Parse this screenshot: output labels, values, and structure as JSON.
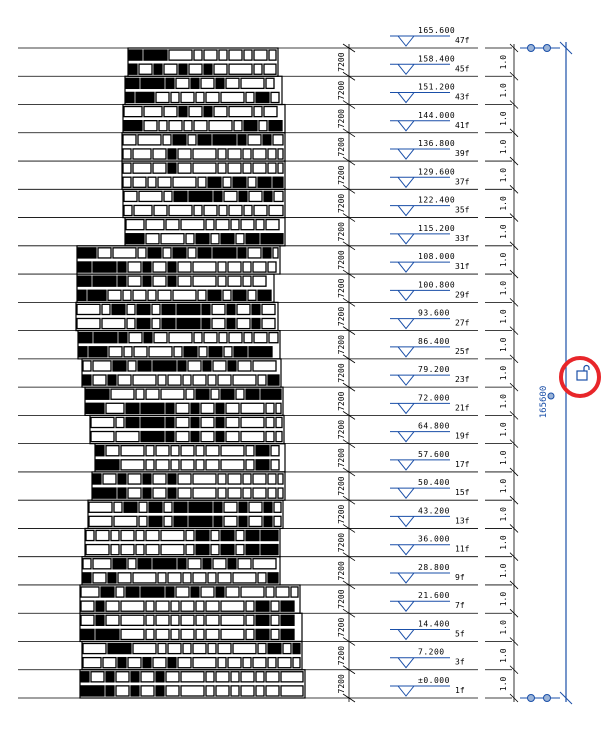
{
  "drawing": {
    "storey_height_label": "7200",
    "small_dim_label": "1.0",
    "total_height_label": "165600",
    "accent_color": "#1a4fa8",
    "highlight_color": "#e8262a",
    "lock_icon": "lock-icon"
  },
  "levels": [
    {
      "elevation": "165.600",
      "floor": "47f"
    },
    {
      "elevation": "158.400",
      "floor": "45f"
    },
    {
      "elevation": "151.200",
      "floor": "43f"
    },
    {
      "elevation": "144.000",
      "floor": "41f"
    },
    {
      "elevation": "136.800",
      "floor": "39f"
    },
    {
      "elevation": "129.600",
      "floor": "37f"
    },
    {
      "elevation": "122.400",
      "floor": "35f"
    },
    {
      "elevation": "115.200",
      "floor": "33f"
    },
    {
      "elevation": "108.000",
      "floor": "31f"
    },
    {
      "elevation": "100.800",
      "floor": "29f"
    },
    {
      "elevation": "93.600",
      "floor": "27f"
    },
    {
      "elevation": "86.400",
      "floor": "25f"
    },
    {
      "elevation": "79.200",
      "floor": "23f"
    },
    {
      "elevation": "72.000",
      "floor": "21f"
    },
    {
      "elevation": "64.800",
      "floor": "19f"
    },
    {
      "elevation": "57.600",
      "floor": "17f"
    },
    {
      "elevation": "50.400",
      "floor": "15f"
    },
    {
      "elevation": "43.200",
      "floor": "13f"
    },
    {
      "elevation": "36.000",
      "floor": "11f"
    },
    {
      "elevation": "28.800",
      "floor": "9f"
    },
    {
      "elevation": "21.600",
      "floor": "7f"
    },
    {
      "elevation": "14.400",
      "floor": "5f"
    },
    {
      "elevation": "7.200",
      "floor": "3f"
    },
    {
      "elevation": "±0.000",
      "floor": "1f"
    }
  ]
}
